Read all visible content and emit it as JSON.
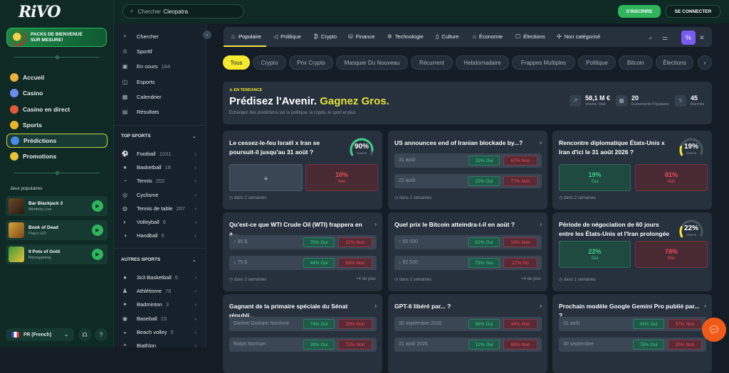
{
  "brand": {
    "logo": "RiVO"
  },
  "promo": {
    "label": "PACKS DE BIENVENUE SUR MESURE!"
  },
  "nav": [
    {
      "label": "Accueil",
      "color": "#e8b23a"
    },
    {
      "label": "Casino",
      "color": "#6a8cf0"
    },
    {
      "label": "Casino en direct",
      "color": "#e05a3a"
    },
    {
      "label": "Sports",
      "color": "#e6b52a"
    },
    {
      "label": "Prédictions",
      "color": "#4a8ae8"
    },
    {
      "label": "Promotions",
      "color": "#e8c23a"
    }
  ],
  "popular_games": {
    "title": "Jeux populaires",
    "items": [
      {
        "name": "Bar Blackjack 3",
        "provider": "Winfinity Live"
      },
      {
        "name": "Book of Dead",
        "provider": "Play'n GO"
      },
      {
        "name": "9 Pots of Gold",
        "provider": "Microgaming"
      }
    ]
  },
  "language": {
    "label": "FR (French)"
  },
  "header": {
    "search_placeholder": "Chercher",
    "search_value": "Cleopatra",
    "signup": "S'INSCRIRE",
    "login": "SE CONNECTER"
  },
  "sports_menu": {
    "top": [
      {
        "label": "Chercher",
        "icon": "search-icon",
        "count": ""
      },
      {
        "label": "Sportif",
        "icon": "trophy-icon",
        "count": ""
      },
      {
        "label": "En cours",
        "icon": "live-icon",
        "count": "184"
      },
      {
        "label": "Esports",
        "icon": "gamepad-icon",
        "count": ""
      },
      {
        "label": "Calendrier",
        "icon": "calendar-icon",
        "count": ""
      },
      {
        "label": "Résultats",
        "icon": "results-icon",
        "count": ""
      }
    ],
    "top_sports_title": "TOP SPORTS",
    "top_sports": [
      {
        "label": "Football",
        "count": "1031"
      },
      {
        "label": "Basketball",
        "count": "18"
      },
      {
        "label": "Tennis",
        "count": "202"
      },
      {
        "label": "Cyclisme",
        "count": ""
      },
      {
        "label": "Tennis de table",
        "count": "207"
      },
      {
        "label": "Volleyball",
        "count": "6"
      },
      {
        "label": "Handball",
        "count": "6"
      }
    ],
    "other_sports_title": "AUTRES SPORTS",
    "other_sports": [
      {
        "label": "3x3 Basketball",
        "count": "6"
      },
      {
        "label": "Athlétisme",
        "count": "78"
      },
      {
        "label": "Badminton",
        "count": "3"
      },
      {
        "label": "Baseball",
        "count": "15"
      },
      {
        "label": "Beach volley",
        "count": "5"
      },
      {
        "label": "Biathlon",
        "count": ""
      }
    ]
  },
  "categories": [
    {
      "label": "Populaire",
      "icon": "flame-icon"
    },
    {
      "label": "Politique",
      "icon": "megaphone-icon"
    },
    {
      "label": "Crypto",
      "icon": "bitcoin-icon"
    },
    {
      "label": "Finance",
      "icon": "coins-icon"
    },
    {
      "label": "Technologie",
      "icon": "chip-icon"
    },
    {
      "label": "Culture",
      "icon": "book-icon"
    },
    {
      "label": "Économie",
      "icon": "bank-icon"
    },
    {
      "label": "Élections",
      "icon": "ballot-icon"
    },
    {
      "label": "Non catégorisé",
      "icon": "tag-icon"
    }
  ],
  "filters": [
    "Tous",
    "Crypto",
    "Prix Crypto",
    "Masquer Du Nouveau",
    "Récurrent",
    "Hebdomadaire",
    "Frappes Multiples",
    "Politique",
    "Bitcoin",
    "Élections"
  ],
  "hero": {
    "tag": "EN TENDANCE",
    "title_a": "Prédisez l'Avenir.",
    "title_b": "Gagnez Gros.",
    "subtitle": "Échangez des prédictions sur la politique, la crypto, le sport et plus.",
    "stats": [
      {
        "value": "58,1 M €",
        "label": "Volume Total"
      },
      {
        "value": "20",
        "label": "Événements Populaires"
      },
      {
        "value": "45",
        "label": "Marchés"
      }
    ]
  },
  "markets": [
    {
      "question": "Le cessez-le-feu Israël x Iran se poursuit-il jusqu'au 31 août ?",
      "chance": 90,
      "chance_label": "chance",
      "yes_locked": true,
      "no_value": "10%",
      "no_label": "Non",
      "footer": "dans 2 semaines",
      "more": ""
    },
    {
      "question": "US announces end of Iranian blockade by...?",
      "rows": [
        {
          "label": "31 août",
          "yes": "33% Oui",
          "no": "67% Non"
        },
        {
          "label": "22 août",
          "yes": "23% Oui",
          "no": "77% Non"
        }
      ],
      "footer": "dans 2 semaines",
      "more": ""
    },
    {
      "question": "Rencontre diplomatique États-Unis x Iran d'ici le 31 août 2026 ?",
      "chance": 19,
      "chance_label": "chance",
      "yes_value": "19%",
      "yes_label": "Oui",
      "no_value": "81%",
      "no_label": "Non",
      "footer": "dans 2 semaines",
      "more": ""
    },
    {
      "question": "Qu'est-ce que WTI Crude Oil (WTI) frappera en a...",
      "rows": [
        {
          "label": "↑ 85 $",
          "yes": "78% Oui",
          "no": "22% Non"
        },
        {
          "label": "↓ 75 $",
          "yes": "44% Oui",
          "no": "56% Non"
        }
      ],
      "footer": "dans 2 semaines",
      "more": "+4 de plus"
    },
    {
      "question": "Quel prix le Bitcoin atteindra-t-il en août ?",
      "rows": [
        {
          "label": "↑ 65 000",
          "yes": "81% Oui",
          "no": "19% Non"
        },
        {
          "label": "↓ 62 500",
          "yes": "73% Yes",
          "no": "27% No"
        }
      ],
      "footer": "dans 2 semaines",
      "more": "+4 de plus"
    },
    {
      "question": "Période de négociation de 60 jours entre les États-Unis et l'Iran prolongée ?",
      "chance": 22,
      "chance_label": "chance",
      "yes_value": "22%",
      "yes_label": "Oui",
      "no_value": "78%",
      "no_label": "Non",
      "footer": "dans 1 semaines",
      "more": ""
    },
    {
      "question": "Gagnant de la primaire spéciale du Sénat républi...",
      "rows": [
        {
          "label": "Darline Graham Nordone",
          "yes": "74% Oui",
          "no": "26% Non"
        },
        {
          "label": "Ralph Norman",
          "yes": "28% Oui",
          "no": "72% Non"
        }
      ],
      "footer": "",
      "more": ""
    },
    {
      "question": "GPT-6 libéré par... ?",
      "rows": [
        {
          "label": "30 septembre 2026",
          "yes": "56% Oui",
          "no": "44% Non"
        },
        {
          "label": "31 août 2026",
          "yes": "12% Oui",
          "no": "88% Non"
        }
      ],
      "footer": "",
      "more": ""
    },
    {
      "question": "Prochain modèle Google Gemini Pro publié par... ?",
      "rows": [
        {
          "label": "31 août",
          "yes": "43% Oui",
          "no": "57% Non"
        },
        {
          "label": "30 septembre",
          "yes": "75% Oui",
          "no": "25% Non"
        }
      ],
      "footer": "",
      "more": ""
    }
  ],
  "colors": {
    "accent_yellow": "#f6ea2e",
    "green": "#2fb55c",
    "yes": "#3fd08a",
    "no": "#ea4d5a",
    "chat": "#f25a1a"
  }
}
